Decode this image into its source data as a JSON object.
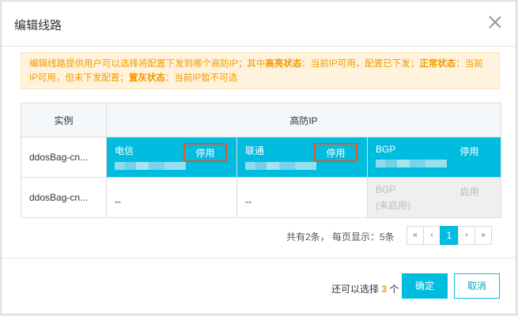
{
  "dialog": {
    "title": "编辑线路"
  },
  "notice": {
    "part1": "编辑线路提供用户可以选择将配置下发到哪个高防IP；其中",
    "bold1": "高亮状态",
    "part2": "：当前IP可用，配置已下发；",
    "bold2": "正常状态",
    "part3": "：当前IP可用，但未下发配置；",
    "bold3": "置灰状态",
    "part4": "：当前IP暂不可选"
  },
  "table": {
    "headers": [
      "实例",
      "高防IP"
    ],
    "rows": [
      {
        "instance": "ddosBag-cn...",
        "ips": [
          {
            "name": "电信",
            "button": "停用",
            "state": "highlighted"
          },
          {
            "name": "联通",
            "button": "停用",
            "state": "highlighted"
          },
          {
            "name": "BGP",
            "button": "停用",
            "state": "highlighted"
          }
        ]
      },
      {
        "instance": "ddosBag-cn...",
        "ips": [
          {
            "name": "--"
          },
          {
            "name": "--"
          },
          {
            "name": "BGP",
            "sub": "(未启用)",
            "button": "启用",
            "state": "disabled"
          }
        ]
      }
    ]
  },
  "pagination": {
    "summary": "共有2条， 每页显示：5条",
    "first": "«",
    "prev": "‹",
    "current": "1",
    "next": "›",
    "last": "»"
  },
  "footer": {
    "remain_prefix": "还可以选择",
    "remain_count": "3",
    "remain_suffix": "个",
    "confirm": "确定",
    "cancel": "取消"
  },
  "colors": {
    "accent": "#00bde0",
    "warning": "#f39a00",
    "highlight_box": "#e2552d"
  }
}
